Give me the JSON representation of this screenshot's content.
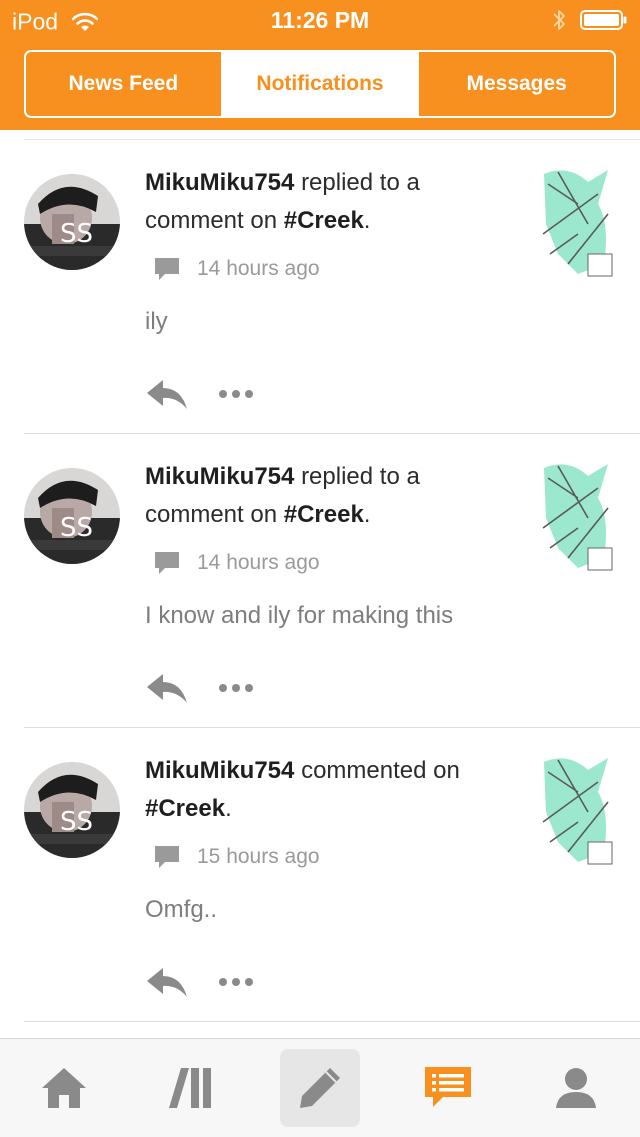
{
  "status_bar": {
    "carrier": "iPod",
    "time": "11:26 PM"
  },
  "colors": {
    "accent": "#f7901e",
    "icon_gray": "#8a8a8a"
  },
  "tabs": [
    {
      "label": "News Feed",
      "active": false
    },
    {
      "label": "Notifications",
      "active": true
    },
    {
      "label": "Messages",
      "active": false
    }
  ],
  "notifications": [
    {
      "user": "MikuMiku754",
      "action": "replied to a comment on",
      "target": "#Creek",
      "time": "14 hours ago",
      "text": "ily"
    },
    {
      "user": "MikuMiku754",
      "action": "replied to a comment on",
      "target": "#Creek",
      "time": "14 hours ago",
      "text": "I know and ily for making this"
    },
    {
      "user": "MikuMiku754",
      "action": "commented on",
      "target": "#Creek",
      "time": "15 hours ago",
      "text": "Omfg.."
    }
  ],
  "tabbar": {
    "icons": [
      "home-icon",
      "library-icon",
      "compose-icon",
      "notifications-icon",
      "profile-icon"
    ],
    "active": "notifications-icon"
  }
}
